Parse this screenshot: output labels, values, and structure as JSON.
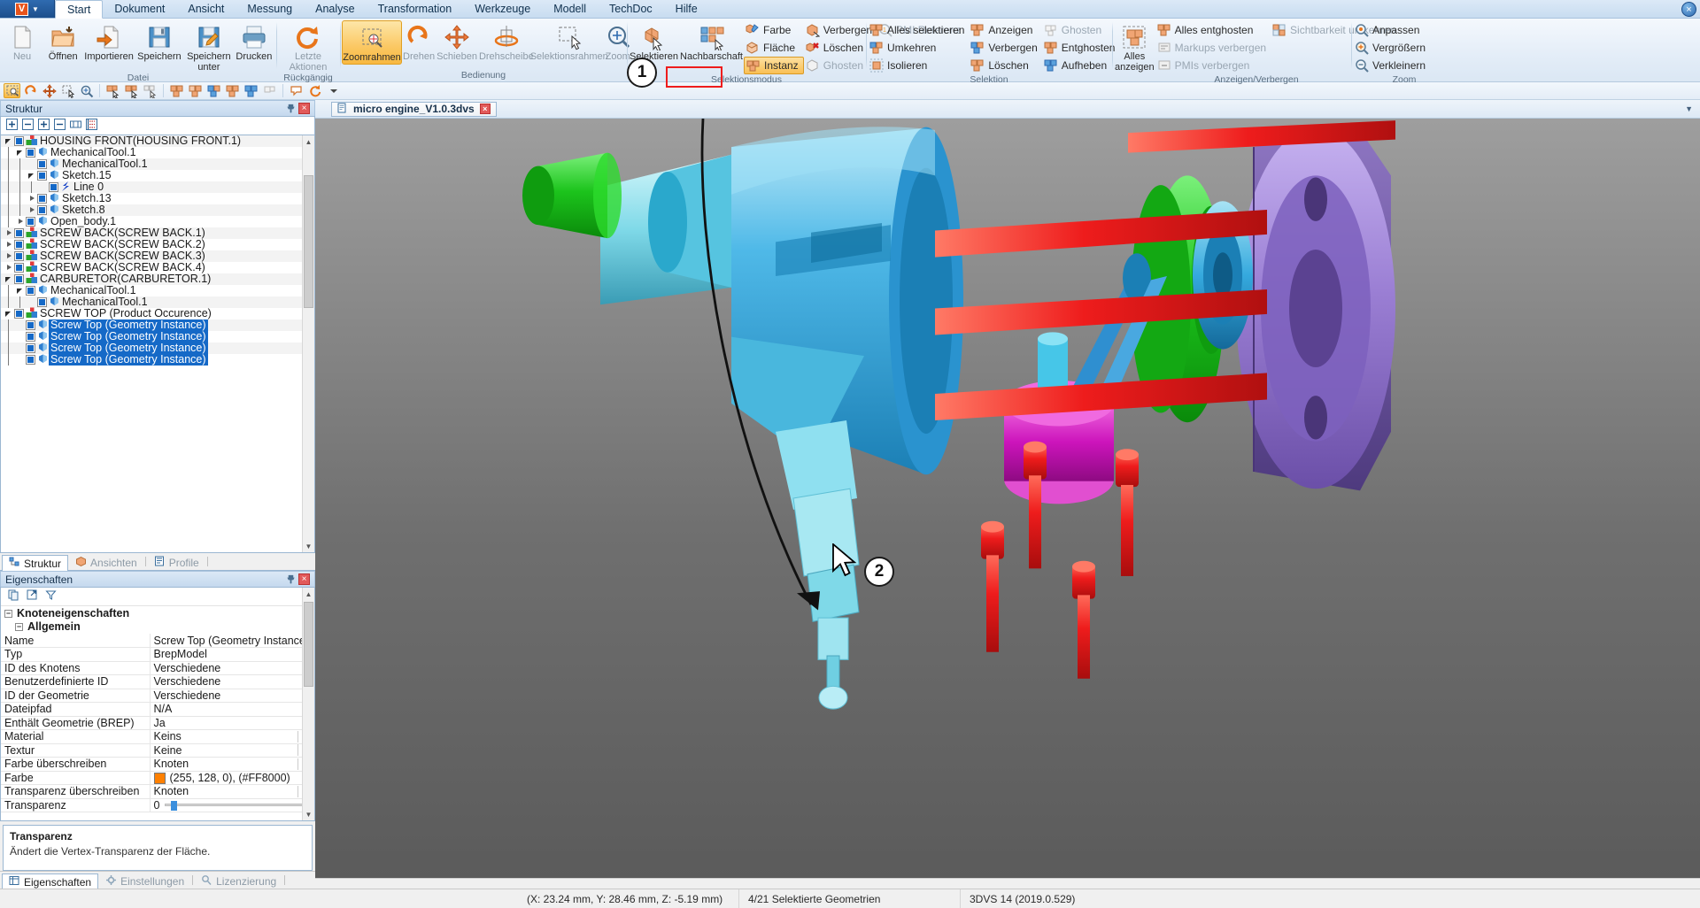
{
  "app": {
    "logo_letter": "V",
    "window_close": "×"
  },
  "menu": {
    "items": [
      {
        "label": "Start",
        "active": true
      },
      {
        "label": "Dokument",
        "active": false
      },
      {
        "label": "Ansicht",
        "active": false
      },
      {
        "label": "Messung",
        "active": false
      },
      {
        "label": "Analyse",
        "active": false
      },
      {
        "label": "Transformation",
        "active": false
      },
      {
        "label": "Werkzeuge",
        "active": false
      },
      {
        "label": "Modell",
        "active": false
      },
      {
        "label": "TechDoc",
        "active": false
      },
      {
        "label": "Hilfe",
        "active": false
      }
    ]
  },
  "ribbon": {
    "groups": [
      {
        "label": "Datei",
        "buttons": [
          {
            "label": "Neu",
            "icon": "new-document-icon",
            "dim": true
          },
          {
            "label": "Öffnen",
            "icon": "open-folder-icon",
            "dim": false
          },
          {
            "label": "Importieren",
            "icon": "import-icon",
            "dim": false
          },
          {
            "label": "Speichern",
            "icon": "save-icon",
            "dim": false
          },
          {
            "label": "Speichern unter",
            "icon": "save-as-icon",
            "dim": false
          },
          {
            "label": "Drucken",
            "icon": "print-icon",
            "dim": false
          }
        ]
      },
      {
        "label": "Rückgängig",
        "buttons": [
          {
            "label": "Letzte Aktionen",
            "icon": "redo-arrow-icon",
            "dim": true,
            "dropdown": true
          }
        ]
      },
      {
        "label": "Bedienung",
        "buttons": [
          {
            "label": "Zoomrahmen",
            "icon": "zoom-frame-icon",
            "dim": false,
            "selected": true
          },
          {
            "label": "Drehen",
            "icon": "rotate-icon",
            "dim": true
          },
          {
            "label": "Schieben",
            "icon": "pan-icon",
            "dim": true
          },
          {
            "label": "Drehscheibe",
            "icon": "turntable-icon",
            "dim": true
          },
          {
            "label": "Selektionsrahmen",
            "icon": "selection-frame-icon",
            "dim": true
          },
          {
            "label": "Zoom",
            "icon": "zoom-icon",
            "dim": true
          }
        ]
      },
      {
        "label": "Selektionsmodus",
        "buttons": [
          {
            "label": "Selektieren",
            "icon": "select-part-icon",
            "dim": false
          },
          {
            "label": "Nachbarschaft",
            "icon": "neighbourhood-icon",
            "dim": false
          }
        ],
        "small_columns": [
          [
            {
              "label": "Farbe",
              "icon": "color-select-icon",
              "dim": false
            },
            {
              "label": "Fläche",
              "icon": "face-select-icon",
              "dim": false
            },
            {
              "label": "Instanz",
              "icon": "instance-select-icon",
              "dim": false,
              "highlight": true
            }
          ],
          [
            {
              "label": "Verbergen",
              "icon": "hide-icon",
              "dim": false
            },
            {
              "label": "Löschen",
              "icon": "delete-icon",
              "dim": false
            },
            {
              "label": "Ghosten",
              "icon": "ghost-icon",
              "dim": true
            }
          ],
          [
            {
              "label": "PMI Referenz",
              "icon": "pmi-reference-icon",
              "dim": true
            }
          ]
        ]
      },
      {
        "label": "Selektion",
        "small_columns": [
          [
            {
              "label": "Alles selektieren",
              "icon": "select-all-icon",
              "dim": false
            },
            {
              "label": "Umkehren",
              "icon": "invert-selection-icon",
              "dim": false
            },
            {
              "label": "Isolieren",
              "icon": "isolate-icon",
              "dim": false
            }
          ],
          [
            {
              "label": "Anzeigen",
              "icon": "show-icon",
              "dim": false
            },
            {
              "label": "Verbergen",
              "icon": "hide-icon",
              "dim": false
            },
            {
              "label": "Löschen",
              "icon": "delete-parts-icon",
              "dim": false
            }
          ],
          [
            {
              "label": "Ghosten",
              "icon": "ghost-icon",
              "dim": true
            },
            {
              "label": "Entghosten",
              "icon": "unghost-icon",
              "dim": false
            },
            {
              "label": "Aufheben",
              "icon": "clear-selection-icon",
              "dim": false
            }
          ]
        ]
      },
      {
        "label": "Anzeigen/Verbergen",
        "buttons": [
          {
            "label": "Alles anzeigen",
            "icon": "show-all-icon",
            "dim": false
          }
        ],
        "small_columns": [
          [
            {
              "label": "Alles entghosten",
              "icon": "unghost-all-icon",
              "dim": false
            },
            {
              "label": "Markups verbergen",
              "icon": "hide-markups-icon",
              "dim": true
            },
            {
              "label": "PMIs verbergen",
              "icon": "hide-pmis-icon",
              "dim": true
            }
          ],
          [
            {
              "label": "Sichtbarkeit umkehren",
              "icon": "invert-visibility-icon",
              "dim": true
            }
          ]
        ]
      },
      {
        "label": "Zoom",
        "small_columns": [
          [
            {
              "label": "Anpassen",
              "icon": "zoom-fit-icon",
              "dim": false
            },
            {
              "label": "Vergrößern",
              "icon": "zoom-in-icon",
              "dim": false
            },
            {
              "label": "Verkleinern",
              "icon": "zoom-out-icon",
              "dim": false
            }
          ]
        ]
      }
    ]
  },
  "quick_toolbar": {
    "icons": [
      "zoom-frame-icon",
      "rotate-icon",
      "pan-icon",
      "selection-frame-icon",
      "zoom-icon",
      "select-part-icon",
      "neighbourhood-icon",
      "instance-select-icon",
      "select-all-icon",
      "invert-selection-icon",
      "show-icon",
      "hide-icon",
      "isolate-icon",
      "ghost-icon",
      "markup-icon",
      "refresh-icon",
      "dropdown-icon"
    ]
  },
  "structure_panel": {
    "title": "Struktur",
    "pin_icon": "pin-icon",
    "close_icon": "close-icon",
    "toolbar_icons": [
      "expand-all-icon",
      "collapse-all-icon",
      "expand-selection-icon",
      "collapse-selection-icon",
      "fit-columns-icon",
      "tree-options-icon"
    ],
    "tree": [
      {
        "label": "HOUSING FRONT(HOUSING FRONT.1)",
        "depth": 1,
        "arrow": "open",
        "icon": "assembly-icon",
        "selected": false
      },
      {
        "label": "MechanicalTool.1",
        "depth": 2,
        "arrow": "open",
        "icon": "part-icon",
        "selected": false
      },
      {
        "label": "MechanicalTool.1",
        "depth": 3,
        "arrow": "none",
        "icon": "part-icon",
        "selected": false
      },
      {
        "label": "Sketch.15",
        "depth": 3,
        "arrow": "open",
        "icon": "part-icon",
        "selected": false
      },
      {
        "label": "Line 0",
        "depth": 4,
        "arrow": "none",
        "icon": "line-icon",
        "selected": false
      },
      {
        "label": "Sketch.13",
        "depth": 3,
        "arrow": "closed",
        "icon": "part-icon",
        "selected": false
      },
      {
        "label": "Sketch.8",
        "depth": 3,
        "arrow": "closed",
        "icon": "part-icon",
        "selected": false
      },
      {
        "label": "Open_body.1",
        "depth": 2,
        "arrow": "closed",
        "icon": "part-icon",
        "selected": false
      },
      {
        "label": "SCREW BACK(SCREW BACK.1)",
        "depth": 1,
        "arrow": "closed",
        "icon": "assembly-icon",
        "selected": false
      },
      {
        "label": "SCREW BACK(SCREW BACK.2)",
        "depth": 1,
        "arrow": "closed",
        "icon": "assembly-icon",
        "selected": false
      },
      {
        "label": "SCREW BACK(SCREW BACK.3)",
        "depth": 1,
        "arrow": "closed",
        "icon": "assembly-icon",
        "selected": false
      },
      {
        "label": "SCREW BACK(SCREW BACK.4)",
        "depth": 1,
        "arrow": "closed",
        "icon": "assembly-icon",
        "selected": false
      },
      {
        "label": "CARBURETOR(CARBURETOR.1)",
        "depth": 1,
        "arrow": "open",
        "icon": "assembly-icon",
        "selected": false
      },
      {
        "label": "MechanicalTool.1",
        "depth": 2,
        "arrow": "open",
        "icon": "part-icon",
        "selected": false
      },
      {
        "label": "MechanicalTool.1",
        "depth": 3,
        "arrow": "none",
        "icon": "part-icon",
        "selected": false
      },
      {
        "label": "SCREW TOP (Product Occurence)",
        "depth": 1,
        "arrow": "open",
        "icon": "assembly-icon",
        "selected": false
      },
      {
        "label": "Screw Top (Geometry Instance)",
        "depth": 2,
        "arrow": "none",
        "icon": "part-icon",
        "selected": true
      },
      {
        "label": "Screw Top (Geometry Instance)",
        "depth": 2,
        "arrow": "none",
        "icon": "part-icon",
        "selected": true
      },
      {
        "label": "Screw Top (Geometry Instance)",
        "depth": 2,
        "arrow": "none",
        "icon": "part-icon",
        "selected": true
      },
      {
        "label": "Screw Top (Geometry Instance)",
        "depth": 2,
        "arrow": "none",
        "icon": "part-icon",
        "selected": true
      }
    ],
    "tabs": [
      {
        "label": "Struktur",
        "icon": "structure-icon",
        "active": true
      },
      {
        "label": "Ansichten",
        "icon": "views-icon",
        "active": false
      },
      {
        "label": "Profile",
        "icon": "profiles-icon",
        "active": false
      }
    ]
  },
  "properties_panel": {
    "title": "Eigenschaften",
    "pin_icon": "pin-icon",
    "close_icon": "close-icon",
    "toolbar_icons": [
      "copy-icon",
      "export-icon",
      "filter-icon"
    ],
    "group": "Knoteneigenschaften",
    "subgroup": "Allgemein",
    "rows": [
      {
        "key": "Name",
        "value": "Screw Top (Geometry Instance)",
        "kind": "text"
      },
      {
        "key": "Typ",
        "value": "BrepModel",
        "kind": "text"
      },
      {
        "key": "ID des Knotens",
        "value": "Verschiedene",
        "kind": "text"
      },
      {
        "key": "Benutzerdefinierte ID",
        "value": "Verschiedene",
        "kind": "text"
      },
      {
        "key": "ID der Geometrie",
        "value": "Verschiedene",
        "kind": "text"
      },
      {
        "key": "Dateipfad",
        "value": "N/A",
        "kind": "text"
      },
      {
        "key": "Enthält Geometrie (BREP)",
        "value": "Ja",
        "kind": "text"
      },
      {
        "key": "Material",
        "value": "Keins",
        "kind": "dropdown"
      },
      {
        "key": "Textur",
        "value": "Keine",
        "kind": "dropdown"
      },
      {
        "key": "Farbe überschreiben",
        "value": "Knoten",
        "kind": "dropdown"
      },
      {
        "key": "Farbe",
        "value": "(255, 128, 0), (#FF8000)",
        "kind": "color",
        "swatch": "#FF8000"
      },
      {
        "key": "Transparenz überschreiben",
        "value": "Knoten",
        "kind": "dropdown"
      },
      {
        "key": "Transparenz",
        "value": "0",
        "kind": "slider"
      }
    ],
    "help": {
      "title": "Transparenz",
      "text": "Ändert die Vertex-Transparenz der Fläche."
    },
    "tabs": [
      {
        "label": "Eigenschaften",
        "icon": "properties-icon",
        "active": true
      },
      {
        "label": "Einstellungen",
        "icon": "settings-icon",
        "active": false
      },
      {
        "label": "Lizenzierung",
        "icon": "license-icon",
        "active": false
      }
    ]
  },
  "document_tab": {
    "title": "micro engine_V1.0.3dvs",
    "close_icon": "×",
    "collapse_icon": "▼"
  },
  "callouts": [
    {
      "number": "1"
    },
    {
      "number": "2"
    }
  ],
  "statusbar": {
    "coordinates": "(X: 23.24 mm, Y: 28.46 mm, Z: -5.19 mm)",
    "selection": "4/21 Selektierte Geometrien",
    "version": "3DVS 14 (2019.0.529)"
  },
  "colors": {
    "accent": "#1569c7",
    "highlight_orange": "#f9c055",
    "annotation_red": "#ee1c1c",
    "farbe_swatch": "#FF8000"
  }
}
